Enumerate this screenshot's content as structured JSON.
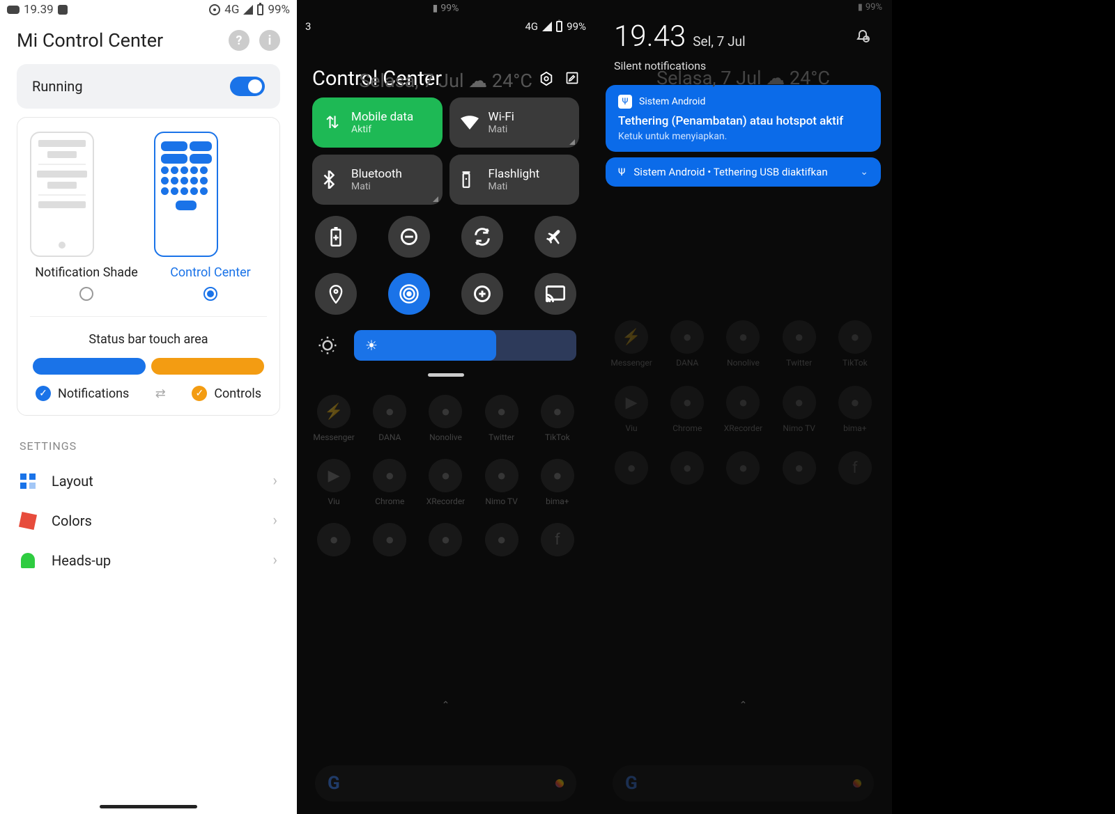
{
  "panel1": {
    "status": {
      "time": "19.39",
      "network": "4G",
      "battery": "99%"
    },
    "title": "Mi Control Center",
    "running_label": "Running",
    "option_a": "Notification Shade",
    "option_b": "Control Center",
    "touch_area_label": "Status bar touch area",
    "legend_notifications": "Notifications",
    "legend_controls": "Controls",
    "settings_header": "SETTINGS",
    "settings": [
      {
        "label": "Layout"
      },
      {
        "label": "Colors"
      },
      {
        "label": "Heads-up"
      }
    ]
  },
  "panel2": {
    "status": {
      "left": "3",
      "network": "4G",
      "battery": "99%",
      "top_battery": "99%"
    },
    "bg_day": "Selasa, 7 Jul",
    "bg_temp": "24°C",
    "title": "Control Center",
    "tiles": [
      {
        "name": "Mobile data",
        "state": "Aktif",
        "on": true
      },
      {
        "name": "Wi-Fi",
        "state": "Mati",
        "on": false
      },
      {
        "name": "Bluetooth",
        "state": "Mati",
        "on": false
      },
      {
        "name": "Flashlight",
        "state": "Mati",
        "on": false
      }
    ],
    "circle_icons": [
      "battery-saver",
      "dnd",
      "auto-rotate",
      "airplane",
      "location",
      "hotspot",
      "data-saver",
      "cast"
    ],
    "apps_row": [
      "Messenger",
      "DANA",
      "Nonolive",
      "Twitter",
      "TikTok",
      "Viu",
      "Chrome",
      "XRecorder",
      "Nimo TV",
      "bima+"
    ]
  },
  "panel3": {
    "status": {
      "battery": "99%"
    },
    "time": "19.43",
    "date": "Sel, 7 Jul",
    "bg_day": "Selasa, 7 Jul",
    "bg_temp": "24°C",
    "silent_header": "Silent notifications",
    "notif1": {
      "app": "Sistem Android",
      "title": "Tethering (Penambatan) atau hotspot aktif",
      "sub": "Ketuk untuk menyiapkan."
    },
    "notif2": {
      "text": "Sistem Android • Tethering USB diaktifkan"
    },
    "apps_row": [
      "Messenger",
      "DANA",
      "Nonolive",
      "Twitter",
      "TikTok",
      "Viu",
      "Chrome",
      "XRecorder",
      "Nimo TV",
      "bima+"
    ]
  }
}
